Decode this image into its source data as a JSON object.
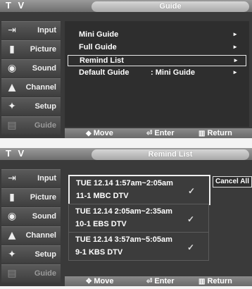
{
  "screen1": {
    "tv_label": "T V",
    "title": "Guide",
    "sidebar": [
      {
        "label": "Input",
        "icon": "input-icon"
      },
      {
        "label": "Picture",
        "icon": "picture-icon"
      },
      {
        "label": "Sound",
        "icon": "sound-icon"
      },
      {
        "label": "Channel",
        "icon": "channel-icon"
      },
      {
        "label": "Setup",
        "icon": "setup-icon"
      },
      {
        "label": "Guide",
        "icon": "guide-icon"
      }
    ],
    "menu": [
      {
        "label": "Mini Guide",
        "value": "",
        "arrow": "►"
      },
      {
        "label": "Full Guide",
        "value": "",
        "arrow": "►"
      },
      {
        "label": "Remind List",
        "value": "",
        "arrow": "►"
      },
      {
        "label": "Default Guide",
        "value": ": Mini Guide",
        "arrow": "►"
      }
    ],
    "bottom": {
      "move": "Move",
      "enter": "Enter",
      "return": "Return"
    }
  },
  "screen2": {
    "tv_label": "T V",
    "title": "Remind List",
    "sidebar": [
      {
        "label": "Input",
        "icon": "input-icon"
      },
      {
        "label": "Picture",
        "icon": "picture-icon"
      },
      {
        "label": "Sound",
        "icon": "sound-icon"
      },
      {
        "label": "Channel",
        "icon": "channel-icon"
      },
      {
        "label": "Setup",
        "icon": "setup-icon"
      },
      {
        "label": "Guide",
        "icon": "guide-icon"
      }
    ],
    "reminders": [
      {
        "line1": "TUE  12.14   1:57am~2:05am",
        "line2": "11-1  MBC  DTV",
        "check": "✓"
      },
      {
        "line1": "TUE  12.14   2:05am~2:35am",
        "line2": "10-1  EBS  DTV",
        "check": "✓"
      },
      {
        "line1": "TUE  12.14   3:57am~5:05am",
        "line2": "9-1  KBS  DTV",
        "check": "✓"
      }
    ],
    "cancel_all": "Cancel All",
    "bottom": {
      "move": "Move",
      "enter": "Enter",
      "return": "Return"
    }
  }
}
